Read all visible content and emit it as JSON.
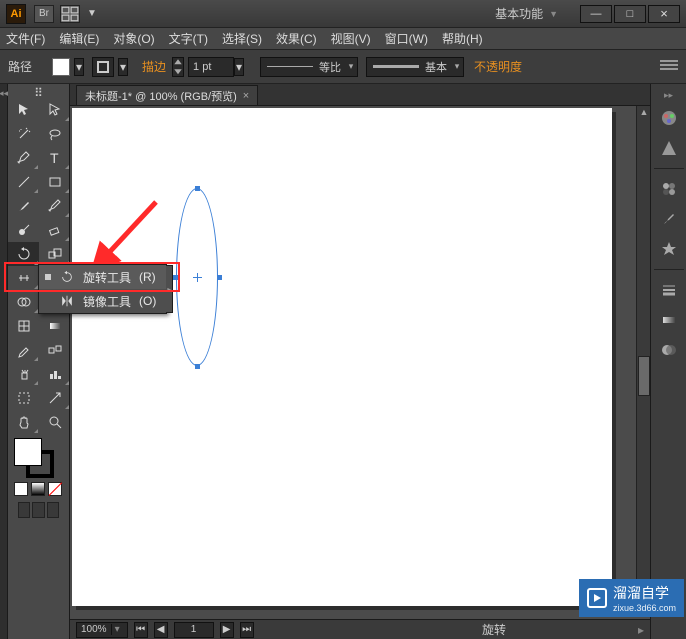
{
  "titlebar": {
    "logo": "Ai",
    "workspace": "基本功能"
  },
  "window_buttons": {
    "min": "—",
    "max": "□",
    "close": "×"
  },
  "menu": [
    "文件(F)",
    "编辑(E)",
    "对象(O)",
    "文字(T)",
    "选择(S)",
    "效果(C)",
    "视图(V)",
    "窗口(W)",
    "帮助(H)"
  ],
  "controlbar": {
    "mode": "路径",
    "stroke_label": "描边",
    "stroke_pt": "1 pt",
    "uniform": "等比",
    "basic": "基本",
    "opacity": "不透明度"
  },
  "doc_tab": {
    "title": "未标题-1* @ 100% (RGB/预览)"
  },
  "flyout": {
    "rotate": "旋转工具",
    "rotate_key": "(R)",
    "reflect": "镜像工具",
    "reflect_key": "(O)"
  },
  "statusbar": {
    "zoom": "100%",
    "page": "1",
    "tool": "旋转"
  },
  "watermark": {
    "brand": "溜溜自学",
    "url": "zixue.3d66.com"
  }
}
